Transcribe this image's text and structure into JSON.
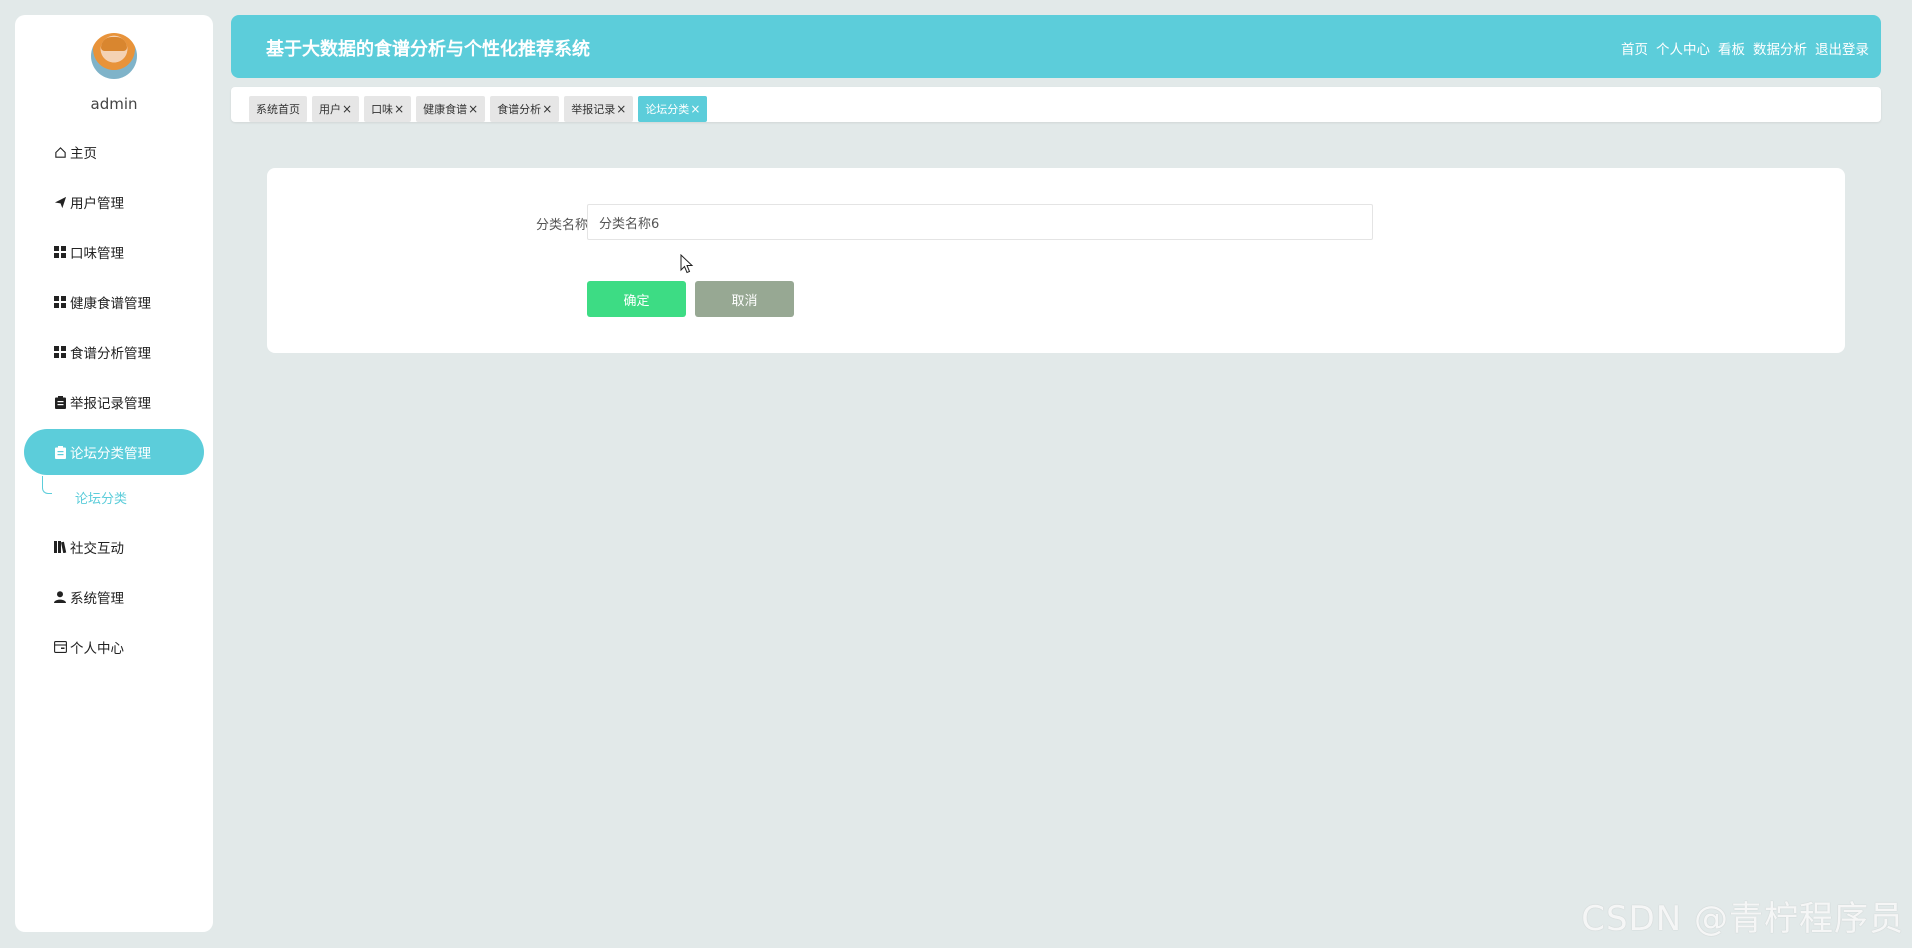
{
  "sidebar": {
    "username": "admin",
    "items": [
      {
        "label": "主页",
        "icon": "home-icon"
      },
      {
        "label": "用户管理",
        "icon": "send-icon"
      },
      {
        "label": "口味管理",
        "icon": "grid-icon"
      },
      {
        "label": "健康食谱管理",
        "icon": "grid-icon"
      },
      {
        "label": "食谱分析管理",
        "icon": "grid-icon"
      },
      {
        "label": "举报记录管理",
        "icon": "clipboard-icon"
      },
      {
        "label": "论坛分类管理",
        "icon": "clipboard-icon",
        "active": true
      },
      {
        "label": "社交互动",
        "icon": "books-icon"
      },
      {
        "label": "系统管理",
        "icon": "user-icon"
      },
      {
        "label": "个人中心",
        "icon": "card-icon"
      }
    ],
    "submenu": {
      "label": "论坛分类"
    }
  },
  "header": {
    "title": "基于大数据的食谱分析与个性化推荐系统",
    "nav": [
      "首页",
      "个人中心",
      "看板",
      "数据分析",
      "退出登录"
    ]
  },
  "tabs": [
    {
      "label": "系统首页",
      "closable": false
    },
    {
      "label": "用户",
      "closable": true
    },
    {
      "label": "口味",
      "closable": true
    },
    {
      "label": "健康食谱",
      "closable": true
    },
    {
      "label": "食谱分析",
      "closable": true
    },
    {
      "label": "举报记录",
      "closable": true
    },
    {
      "label": "论坛分类",
      "closable": true,
      "active": true
    }
  ],
  "form": {
    "field_label": "分类名称",
    "field_value": "分类名称6",
    "confirm_label": "确定",
    "cancel_label": "取消"
  },
  "watermark": "CSDN @青柠程序员",
  "colors": {
    "accent": "#5ccdda",
    "confirm": "#3ddc84",
    "cancel": "#97a893",
    "background": "#e2e9e9"
  }
}
